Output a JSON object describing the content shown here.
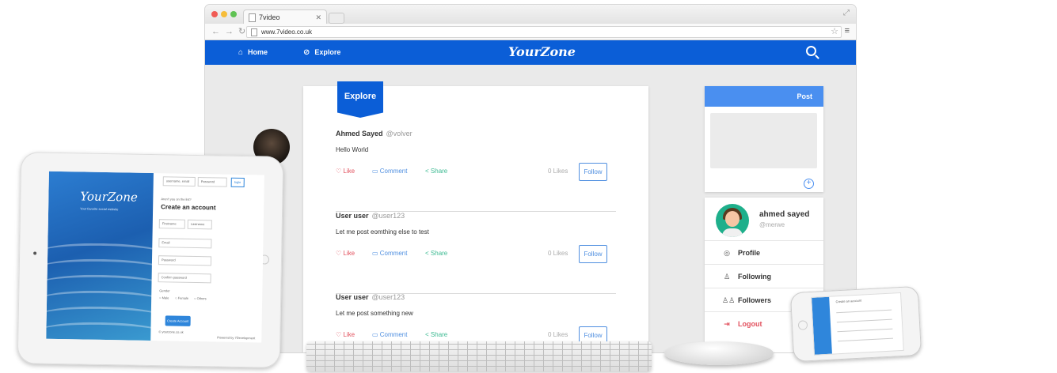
{
  "browser": {
    "tab_title": "7video",
    "url": "www.7video.co.uk"
  },
  "navbar": {
    "home": "Home",
    "explore": "Explore",
    "brand": "YourZone"
  },
  "feed": {
    "ribbon": "Explore",
    "posts": [
      {
        "name": "Ahmed Sayed",
        "handle": "@volver",
        "text": "Hello World",
        "like": "Like",
        "comment": "Comment",
        "share": "Share",
        "likes": "0 Likes",
        "follow": "Follow"
      },
      {
        "name": "User user",
        "handle": "@user123",
        "text": "Let me post eomthing else to test",
        "like": "Like",
        "comment": "Comment",
        "share": "Share",
        "likes": "0 Likes",
        "follow": "Follow"
      },
      {
        "name": "User user",
        "handle": "@user123",
        "text": "Let me post something new",
        "like": "Like",
        "comment": "Comment",
        "share": "Share",
        "likes": "0 Likes",
        "follow": "Follow"
      }
    ]
  },
  "post_panel": {
    "title": "Post"
  },
  "profile": {
    "name": "ahmed sayed",
    "handle": "@merwe",
    "menu": [
      {
        "label": "Profile",
        "icon": "user-circle-icon"
      },
      {
        "label": "Following",
        "icon": "user-icon"
      },
      {
        "label": "Followers",
        "icon": "users-icon"
      },
      {
        "label": "Logout",
        "icon": "logout-icon"
      }
    ]
  },
  "tablet": {
    "brand": "YourZone",
    "tagline": "Your favorite social website",
    "login_user_placeholder": "username, email",
    "login_pass_placeholder": "Password",
    "login_button": "login",
    "prompt": "Aren't you on the list?",
    "title": "Create an account",
    "first_name": "Firstname",
    "last_name": "Lastname",
    "email": "Email",
    "password": "Password",
    "confirm_password": "Confirm password",
    "gender_label": "Gender",
    "gender_options": [
      "Male",
      "Female",
      "Others"
    ],
    "create_button": "Create Account",
    "footer_left": "© yourzone.co.uk",
    "footer_right": "Powered by 7Development"
  },
  "phone": {
    "title": "Create an account"
  },
  "colors": {
    "primary": "#0b5ed7",
    "like": "#e2515e",
    "comment": "#4f8fe0",
    "share": "#3dba92",
    "post_header": "#4a8ff0"
  }
}
